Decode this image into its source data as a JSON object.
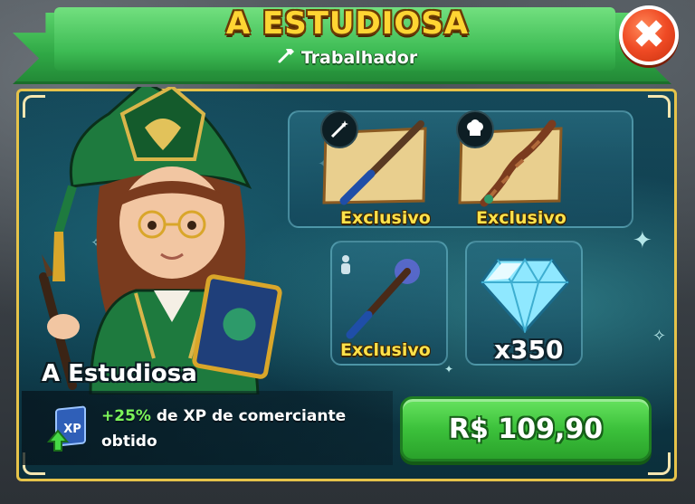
{
  "header": {
    "title": "A ESTUDIOSA",
    "subtitle": "Trabalhador",
    "close_symbol": "✖"
  },
  "character": {
    "name": "A Estudiosa",
    "perk_value": "+25%",
    "perk_text_1": " de XP de comerciante",
    "perk_text_2": "obtido"
  },
  "items": [
    {
      "label": "Exclusivo",
      "icon": "magic-wand-icon",
      "kind": "wand-scroll"
    },
    {
      "label": "Exclusivo",
      "icon": "chef-hat-icon",
      "kind": "twisted-wand-scroll"
    },
    {
      "label": "Exclusivo",
      "icon": "person-icon",
      "kind": "staff-orb"
    },
    {
      "label": "x350",
      "icon": "gem-icon",
      "kind": "diamond"
    }
  ],
  "purchase": {
    "price": "R$ 109,90"
  },
  "colors": {
    "accent_green": "#3cc13b",
    "title_yellow": "#ffd533",
    "close_red": "#ef4a24",
    "panel_teal": "#0e3a4a",
    "frame_gold": "#e6c34a"
  }
}
